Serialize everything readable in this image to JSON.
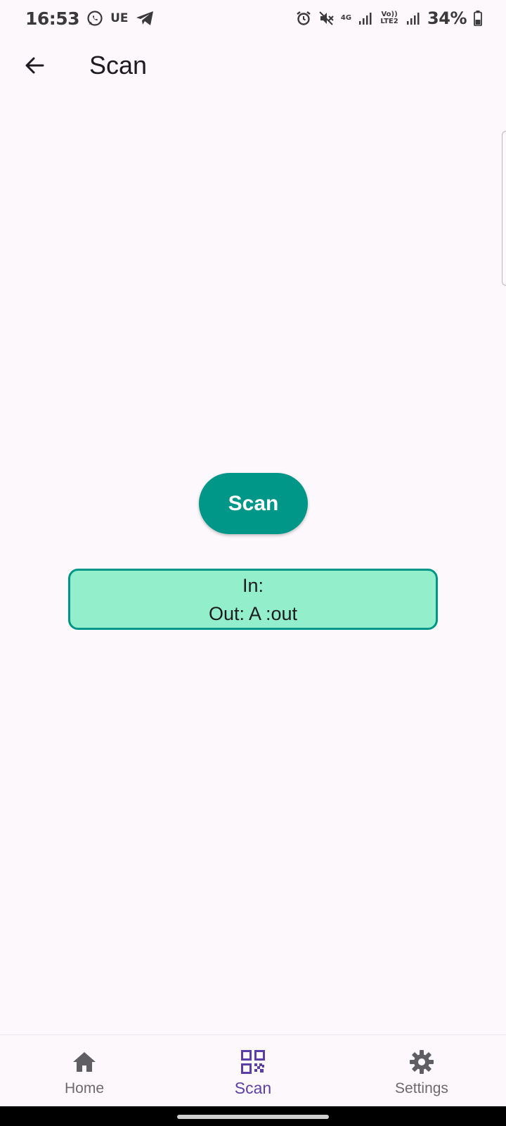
{
  "status_bar": {
    "time": "16:53",
    "carrier_text": "UE",
    "network_4g": "4G",
    "volte": "Vo)) LTE2",
    "battery": "34%"
  },
  "app_bar": {
    "title": "Scan"
  },
  "main": {
    "scan_button_label": "Scan",
    "result": {
      "in_line": "In:",
      "out_line": "Out: A :out"
    }
  },
  "bottom_nav": {
    "items": [
      {
        "label": "Home",
        "icon": "home-icon",
        "active": false
      },
      {
        "label": "Scan",
        "icon": "qr-code-icon",
        "active": true
      },
      {
        "label": "Settings",
        "icon": "gear-icon",
        "active": false
      }
    ]
  },
  "colors": {
    "accent": "#009688",
    "result_bg": "#93eecb",
    "active_nav": "#5b3ea8",
    "background": "#fdf8fc"
  }
}
